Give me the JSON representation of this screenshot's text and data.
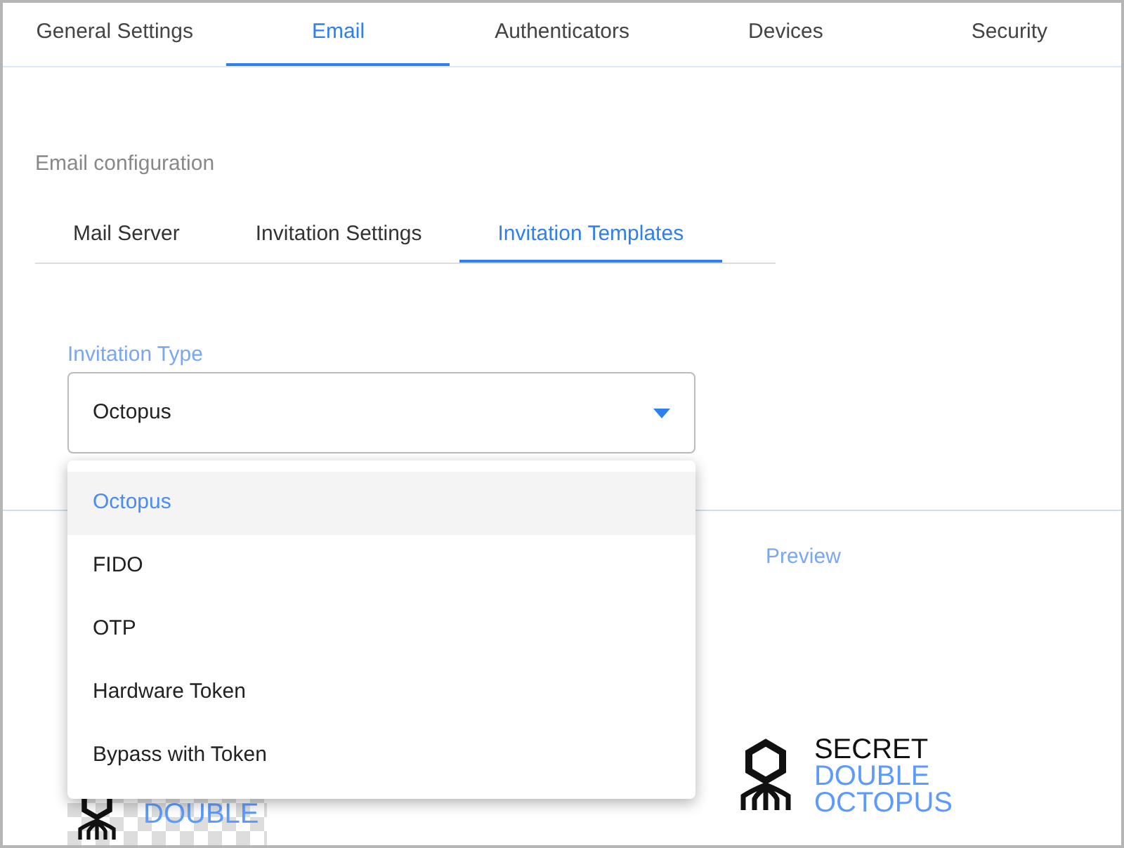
{
  "tabs": [
    {
      "label": "General Settings",
      "selected": false
    },
    {
      "label": "Email",
      "selected": true
    },
    {
      "label": "Authenticators",
      "selected": false
    },
    {
      "label": "Devices",
      "selected": false
    },
    {
      "label": "Security",
      "selected": false
    }
  ],
  "section_title": "Email configuration",
  "subtabs": [
    {
      "label": "Mail Server",
      "selected": false
    },
    {
      "label": "Invitation Settings",
      "selected": false
    },
    {
      "label": "Invitation Templates",
      "selected": true
    }
  ],
  "invitation_type": {
    "label": "Invitation Type",
    "value": "Octopus",
    "expanded": true,
    "options": [
      {
        "label": "Octopus",
        "selected": true
      },
      {
        "label": "FIDO",
        "selected": false
      },
      {
        "label": "OTP",
        "selected": false
      },
      {
        "label": "Hardware Token",
        "selected": false
      },
      {
        "label": "Bypass with Token",
        "selected": false
      }
    ]
  },
  "preview_label": "Preview",
  "logo_left": {
    "line_2": "DOUBLE"
  },
  "logo_right": {
    "line_1": "SECRET",
    "line_2": "DOUBLE",
    "line_3": "OCTOPUS"
  }
}
